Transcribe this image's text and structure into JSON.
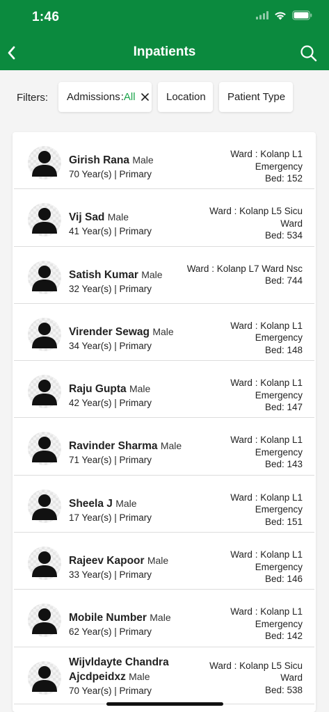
{
  "status_bar": {
    "time": "1:46"
  },
  "header": {
    "title": "Inpatients"
  },
  "filters": {
    "label": "Filters:",
    "admissions_label": "Admissions",
    "admissions_separator": ":",
    "admissions_value": "All",
    "location_label": "Location",
    "patient_type_label": "Patient Type"
  },
  "patients": [
    {
      "name": "Girish Rana",
      "gender": "Male",
      "meta": "70 Year(s) | Primary",
      "ward_line1": "Ward : Kolanp L1",
      "ward_line2": "Emergency",
      "bed": "Bed: 152"
    },
    {
      "name": "Vij Sad",
      "gender": "Male",
      "meta": "41 Year(s) | Primary",
      "ward_line1": "Ward : Kolanp L5 Sicu",
      "ward_line2": "Ward",
      "bed": "Bed: 534"
    },
    {
      "name": "Satish Kumar",
      "gender": "Male",
      "meta": "32 Year(s) | Primary",
      "ward_line1": "Ward : Kolanp L7 Ward Nsc",
      "ward_line2": "",
      "bed": "Bed: 744"
    },
    {
      "name": "Virender Sewag",
      "gender": "Male",
      "meta": "34 Year(s) | Primary",
      "ward_line1": "Ward : Kolanp L1",
      "ward_line2": "Emergency",
      "bed": "Bed: 148"
    },
    {
      "name": "Raju Gupta",
      "gender": "Male",
      "meta": "42 Year(s) | Primary",
      "ward_line1": "Ward : Kolanp L1",
      "ward_line2": "Emergency",
      "bed": "Bed: 147"
    },
    {
      "name": "Ravinder Sharma",
      "gender": "Male",
      "meta": "71 Year(s) | Primary",
      "ward_line1": "Ward : Kolanp L1",
      "ward_line2": "Emergency",
      "bed": "Bed: 143"
    },
    {
      "name": "Sheela J",
      "gender": "Male",
      "meta": "17 Year(s) | Primary",
      "ward_line1": "Ward : Kolanp L1",
      "ward_line2": "Emergency",
      "bed": "Bed: 151"
    },
    {
      "name": "Rajeev Kapoor",
      "gender": "Male",
      "meta": "33 Year(s) | Primary",
      "ward_line1": "Ward : Kolanp L1",
      "ward_line2": "Emergency",
      "bed": "Bed: 146"
    },
    {
      "name": "Mobile Number",
      "gender": "Male",
      "meta": "62 Year(s) | Primary",
      "ward_line1": "Ward : Kolanp L1",
      "ward_line2": "Emergency",
      "bed": "Bed: 142"
    },
    {
      "name": "Wijvldayte Chandra Ajcdpeidxz",
      "gender": "Male",
      "meta": "70 Year(s) | Primary",
      "ward_line1": "Ward : Kolanp L5 Sicu",
      "ward_line2": "Ward",
      "bed": "Bed: 538"
    }
  ],
  "colors": {
    "header_green": "#0b8a3e",
    "accent_green": "#1aa34a"
  },
  "icons": [
    "back-chevron-icon",
    "search-icon",
    "close-icon",
    "wifi-icon",
    "signal-icon",
    "battery-icon",
    "person-avatar-icon"
  ]
}
